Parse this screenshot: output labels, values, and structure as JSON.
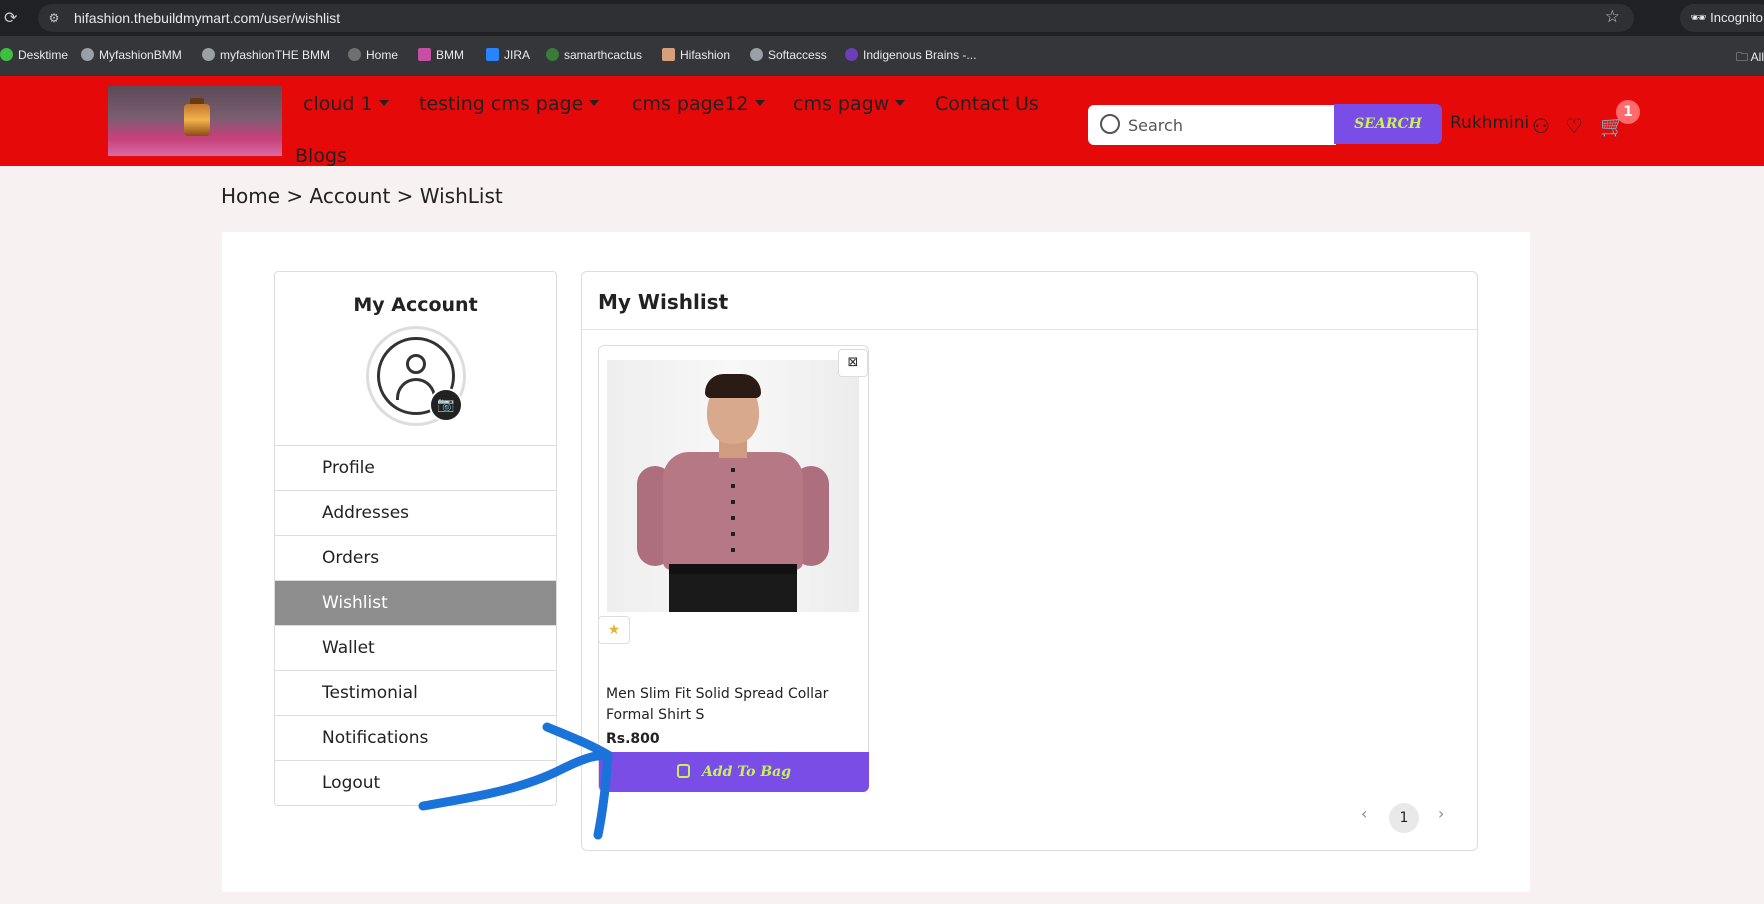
{
  "browser": {
    "url": "hifashion.thebuildmymart.com/user/wishlist",
    "incognito_label": "Incognito",
    "bookmarks": [
      "Desktime",
      "MyfashionBMM",
      "myfashionTHE BMM",
      "Home",
      "BMM",
      "JIRA",
      "samarthcactus",
      "Hifashion",
      "Softaccess",
      "Indigenous Brains -..."
    ],
    "all_bookmarks_label": "All"
  },
  "header": {
    "nav": [
      "cloud 1",
      "testing cms page",
      "cms page12",
      "cms pagw",
      "Contact Us",
      "Blogs"
    ],
    "search_placeholder": "Search",
    "search_button": "SEARCH",
    "username": "Rukhmini",
    "cart_count": "1",
    "colors": {
      "header_bg": "#e50909",
      "accent": "#7a4de6",
      "accent_text": "#c7f05a"
    }
  },
  "breadcrumb": "Home > Account > WishList",
  "account": {
    "title": "My Account",
    "menu": [
      "Profile",
      "Addresses",
      "Orders",
      "Wishlist",
      "Wallet",
      "Testimonial",
      "Notifications",
      "Logout"
    ],
    "active": "Wishlist"
  },
  "wishlist": {
    "title": "My Wishlist",
    "products": [
      {
        "name": "Men Slim Fit Solid Spread Collar Formal Shirt S",
        "price": "Rs.800",
        "button": "Add To Bag"
      }
    ],
    "pagination": {
      "prev": "‹",
      "current": "1",
      "next": "›"
    }
  },
  "icons": {
    "reload": "reload-icon",
    "star": "bookmark-star-icon",
    "search": "search-icon",
    "user": "user-icon",
    "heart": "heart-icon",
    "cart": "cart-icon",
    "camera": "camera-icon",
    "close": "close-icon",
    "rating": "star-icon",
    "bag": "bag-icon"
  }
}
